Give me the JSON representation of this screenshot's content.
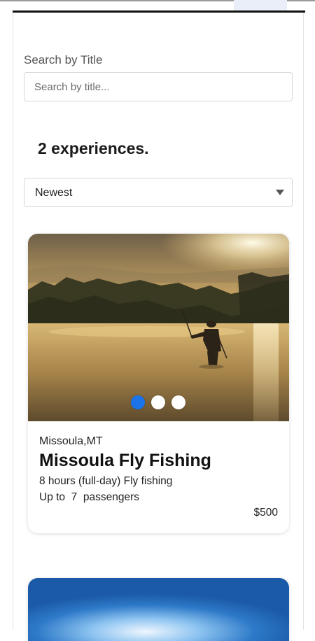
{
  "search": {
    "label": "Search by Title",
    "placeholder": "Search by title..."
  },
  "results": {
    "count_text": "2 experiences."
  },
  "sort": {
    "selected": "Newest"
  },
  "carousel": {
    "dots": 3,
    "active_index": 0
  },
  "listings": [
    {
      "location": "Missoula,MT",
      "title": "Missoula Fly Fishing",
      "duration": "8 hours (full-day) Fly fishing",
      "capacity": "Up to  7  passengers",
      "price": "$500"
    }
  ],
  "colors": {
    "accent": "#1a73e8",
    "border": "#d7d7d7"
  }
}
